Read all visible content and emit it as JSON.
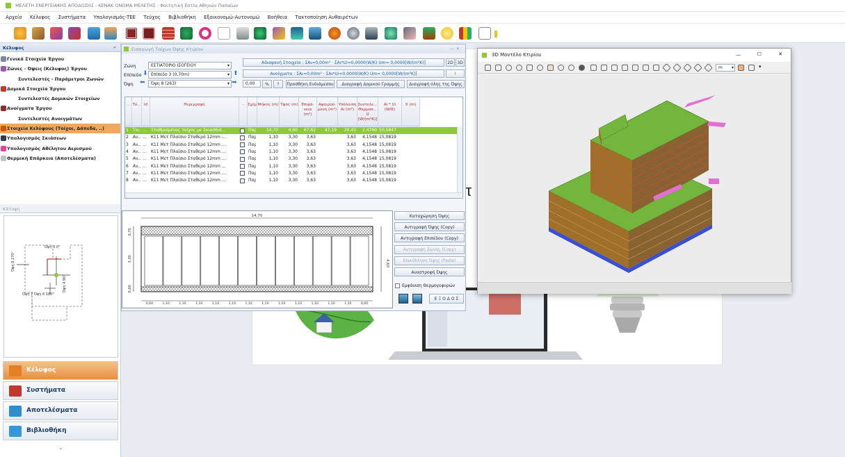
{
  "app": {
    "title": "ΜΕΛΕΤΗ ΕΝΕΡΓΕΙΑΚΗΣ ΑΠΟΔΟΣΗΣ - ΚΕΝΑΚ   ΟΝΟΜΑ ΜΕΛΕΤΗΣ : Φοιτητική Εστία Αθηνών Παπαίων",
    "menu": [
      "Αρχείο",
      "Κέλυφος",
      "Συστήματα",
      "Υπολογισμός-ΤΕΕ",
      "Τεύχος",
      "Βιβλιοθήκη",
      "Εξοικονομώ-Αυτονομώ",
      "Βοήθεια",
      "Τακτοποίηση Αυθαιρέτων"
    ]
  },
  "left_panel": {
    "header": "Κέλυφος",
    "collapse_glyph": "«",
    "items": [
      {
        "label": "Γενικά Στοιχεία Έργου",
        "sub": false,
        "selected": false,
        "icon_color": "#7a8aa0"
      },
      {
        "label": "Ζώνες - Όψεις (Κέλυφος) Έργου",
        "sub": false,
        "selected": false,
        "icon_color": "#9b59b6"
      },
      {
        "label": "Συντελεστές - Παράμετροι Ζωνών",
        "sub": true,
        "selected": false,
        "icon_color": ""
      },
      {
        "label": "Δομικά Στοιχεία Έργου",
        "sub": false,
        "selected": false,
        "icon_color": "#c0392b"
      },
      {
        "label": "Συντελεστές Δομικών Στοιχείων",
        "sub": true,
        "selected": false,
        "icon_color": ""
      },
      {
        "label": "Ανοίγματα Έργου",
        "sub": false,
        "selected": false,
        "icon_color": "#8e2e2e"
      },
      {
        "label": "Συντελεστές Ανοιγμάτων",
        "sub": true,
        "selected": false,
        "icon_color": ""
      },
      {
        "label": "Στοιχεία Κελύφους (Τοίχοι, Δάπεδα, ..)",
        "sub": false,
        "selected": true,
        "icon_color": "#d35400"
      },
      {
        "label": "Υπολογισμός Σκιάσεων",
        "sub": false,
        "selected": false,
        "icon_color": "#2c3e50"
      },
      {
        "label": "Υπολογισμός Αθέλητου Αερισμού",
        "sub": false,
        "selected": false,
        "icon_color": "#e84393"
      },
      {
        "label": "Θερμική Επάρκεια (Αποτελέσματα)",
        "sub": false,
        "selected": false,
        "icon_color": "#bdc3c7"
      }
    ],
    "katopsi_header": "Κάτοψη",
    "katopsi_labels": {
      "opsi1": "Όψη 3 0°",
      "opsi2": "Όψη 7 Όψη 6 180°",
      "left": "Όψη 8 270°",
      "right": "Όψη 4 90°"
    },
    "nav": [
      {
        "label": "Κέλυφος",
        "active": true,
        "icon_color": "#e67e22"
      },
      {
        "label": "Συστήματα",
        "active": false,
        "icon_color": "#c0392b"
      },
      {
        "label": "Αποτελέσματα",
        "active": false,
        "icon_color": "#2c8fc9"
      },
      {
        "label": "Βιβλιοθήκη",
        "active": false,
        "icon_color": "#3498db"
      }
    ],
    "nav_more": "⌄"
  },
  "dialog": {
    "title": "Εισαγωγή Τοίχων Όψης Κτιρίου",
    "zone_label": "Ζώνη",
    "zone_value": "ΕΣΤΙΑΤΟΡΙΟ ΙΣΟΓΕΙΟΥ",
    "level_label": "Επίπεδο",
    "level_value": "Επίπεδο 3 (0,70m)",
    "opsi_label": "Όψη",
    "opsi_value": "Όψη 8 (263)",
    "summary_opaque": "Αδιαφανή Στοιχεία : ΣΑι=0,00m² · ΣΑι*Ui=0,0000(W/K) Um= 0,0000[W/(m²K)]",
    "summary_openings": "Ανοίγματα : ΣΑι=0,00m² · ΣΑι*Ui=0,0000(W/K) Um= 0,0000[W/(m²K)]",
    "btn_2d": "2D",
    "btn_3d": "3D",
    "btn_bang": "!",
    "pct_value": "0,00",
    "pct_label": "%",
    "help_label": "?",
    "add_frame": "Προσθήκη Ενδιάμεσου",
    "del_line": "Διαγραφή Δομικού Γραμμής",
    "del_all": "Διαγραφή όλης της Όψης",
    "columns": [
      "...",
      "Τύ...",
      "Id",
      "Περιγραφή",
      "-",
      "Σχήμα",
      "Μήκος (m)",
      "Ύψος (m)",
      "Επιφά-νεια (m²)",
      "Αφαιρού-μενη (m²)",
      "Υπόλοιπη Ai (m²)",
      "Συντελε... Θερμοπ... U [W/(m²K)]",
      "Ai * Ui (W/K)",
      "X (m)"
    ],
    "rows": [
      {
        "n": "1",
        "t": "Τοι...",
        "id": "...",
        "desc": "Σταθμισμένος τοίχος με Σκιασ6ιά...",
        "shape": "Παρ...",
        "len": "14,70",
        "h": "4,60",
        "area": "67,62",
        "sub": "47,19",
        "rest": "20,43",
        "u": "2,4760",
        "aiui": "50,5847",
        "x": "",
        "sel": true
      },
      {
        "n": "2",
        "t": "Αν...",
        "id": "...",
        "desc": "Κ11 Μετ Πλαίσιο Σταθερό 12mm ...",
        "shape": "Παρ...",
        "len": "1,10",
        "h": "3,30",
        "area": "3,63",
        "sub": "",
        "rest": "3,63",
        "u": "4,1548",
        "aiui": "15,0819",
        "x": "",
        "sel": false
      },
      {
        "n": "3",
        "t": "Αν...",
        "id": "...",
        "desc": "Κ11 Μετ Πλαίσιο Σταθερό 12mm ...",
        "shape": "Παρ...",
        "len": "1,10",
        "h": "3,30",
        "area": "3,63",
        "sub": "",
        "rest": "3,63",
        "u": "4,1548",
        "aiui": "15,0819",
        "x": "",
        "sel": false
      },
      {
        "n": "4",
        "t": "Αν...",
        "id": "...",
        "desc": "Κ11 Μετ Πλαίσιο Σταθερό 12mm ...",
        "shape": "Παρ...",
        "len": "1,10",
        "h": "3,30",
        "area": "3,63",
        "sub": "",
        "rest": "3,63",
        "u": "4,1548",
        "aiui": "15,0819",
        "x": "",
        "sel": false
      },
      {
        "n": "5",
        "t": "Αν...",
        "id": "...",
        "desc": "Κ11 Μετ Πλαίσιο Σταθερό 12mm ...",
        "shape": "Παρ...",
        "len": "1,10",
        "h": "3,30",
        "area": "3,63",
        "sub": "",
        "rest": "3,63",
        "u": "4,1548",
        "aiui": "15,0819",
        "x": "",
        "sel": false
      },
      {
        "n": "6",
        "t": "Αν...",
        "id": "...",
        "desc": "Κ11 Μετ Πλαίσιο Σταθερό 12mm ...",
        "shape": "Παρ...",
        "len": "1,10",
        "h": "3,30",
        "area": "3,63",
        "sub": "",
        "rest": "3,63",
        "u": "4,1548",
        "aiui": "15,0819",
        "x": "",
        "sel": false
      },
      {
        "n": "7",
        "t": "Αν...",
        "id": "...",
        "desc": "Κ11 Μετ Πλαίσιο Σταθερό 12mm ...",
        "shape": "Παρ...",
        "len": "1,10",
        "h": "3,30",
        "area": "3,63",
        "sub": "",
        "rest": "3,63",
        "u": "4,1548",
        "aiui": "15,0819",
        "x": "",
        "sel": false
      },
      {
        "n": "8",
        "t": "Αν...",
        "id": "...",
        "desc": "Κ11 Μετ Πλαίσιο Σταθερό 12mm ...",
        "shape": "Παρ...",
        "len": "1,10",
        "h": "3,30",
        "area": "3,63",
        "sub": "",
        "rest": "3,63",
        "u": "4,1548",
        "aiui": "15,0819",
        "x": "",
        "sel": false
      }
    ],
    "plan": {
      "width_label": "14,70",
      "height_label": "4,60",
      "left_labels": [
        "0,70",
        "3,30",
        "0,60"
      ],
      "window_count": 12,
      "bottom_labels": [
        "0,60",
        "1,10",
        "1,10",
        "1,10",
        "1,10",
        "1,10",
        "1,10",
        "1,10",
        "1,10",
        "1,10",
        "1,10",
        "1,10",
        "1,10",
        "0,60"
      ]
    },
    "right_buttons": [
      {
        "label": "Καταχώρηση Όψης",
        "disabled": false
      },
      {
        "label": "Αντιγραφή Όψης (Copy)",
        "disabled": false
      },
      {
        "label": "Αντιγραφή Επιπέδου (Copy)",
        "disabled": false
      },
      {
        "label": "Αντιγραφή Ζώνης (Copy)",
        "disabled": true
      },
      {
        "label": "Επικόλληση Όψης (Paste)",
        "disabled": true
      },
      {
        "label": "Αναστροφή Όψης",
        "disabled": false
      }
    ],
    "show_thermal": "Εμφάνιση Θερμογεφυρών",
    "exit": "Ε Ξ Ο Δ Ο Σ"
  },
  "window_3d": {
    "title": "3D Μοντέλο Κτιρίου",
    "minimize": "—",
    "maximize": "☐",
    "close": "✕",
    "zoom_value": "m"
  },
  "canvas": {
    "fragment": "Κτ"
  },
  "colors": {
    "green_roof": "#72b63e",
    "selection": "#8dc93a",
    "nav_active": "#ec9a4d",
    "title_blue": "#1f3d7a",
    "red_text": "#c0282e"
  }
}
